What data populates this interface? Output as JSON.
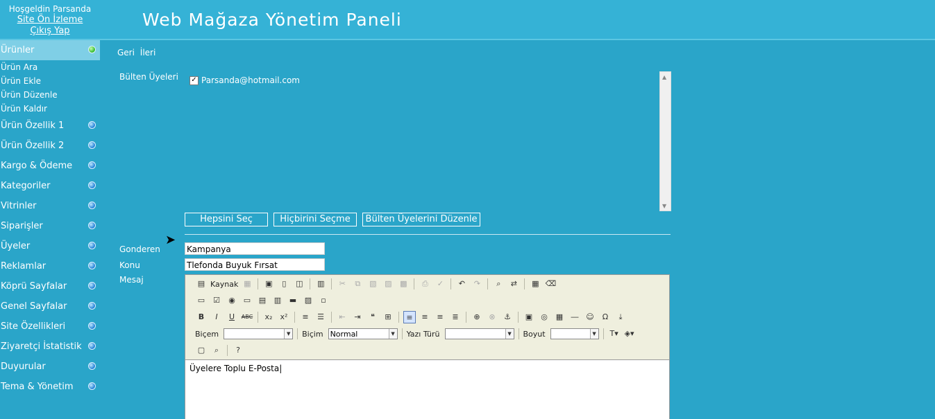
{
  "header": {
    "welcome": "Hoşgeldin Parsanda",
    "preview_link": "Site Ön İzleme",
    "logout_link": "Çıkış Yap",
    "title": "Web Mağaza Yönetim Paneli"
  },
  "sidebar": {
    "active": "Ürünler",
    "sub_items": [
      "Ürün Ara",
      "Ürün Ekle",
      "Ürün Düzenle",
      "Ürün Kaldır"
    ],
    "items": [
      "Ürün Özellik 1",
      "Ürün Özellik 2",
      "Kargo & Ödeme",
      "Kategoriler",
      "Vitrinler",
      "Siparişler",
      "Üyeler",
      "Reklamlar",
      "Köprü Sayfalar",
      "Genel Sayfalar",
      "Site Özellikleri",
      "Ziyaretçi İstatistik",
      "Duyurular",
      "Tema & Yönetim"
    ]
  },
  "nav": {
    "back": "Geri",
    "forward": "İleri"
  },
  "bulletin": {
    "label": "Bülten Üyeleri",
    "members": [
      "Parsanda@hotmail.com"
    ],
    "buttons": {
      "select_all": "Hepsini Seç",
      "select_none": "Hiçbirini Seçme",
      "edit": "Bülten Üyelerini Düzenle"
    }
  },
  "form": {
    "sender_label": "Gonderen",
    "sender_value": "Kampanya",
    "subject_label": "Konu",
    "subject_value": "Tlefonda Buyuk Fırsat",
    "message_label": "Mesaj"
  },
  "editor": {
    "source_label": "Kaynak",
    "style_label": "Biçem",
    "format_label": "Biçim",
    "format_value": "Normal",
    "font_label": "Yazı Türü",
    "size_label": "Boyut",
    "content": "Üyelere Toplu E-Posta"
  }
}
